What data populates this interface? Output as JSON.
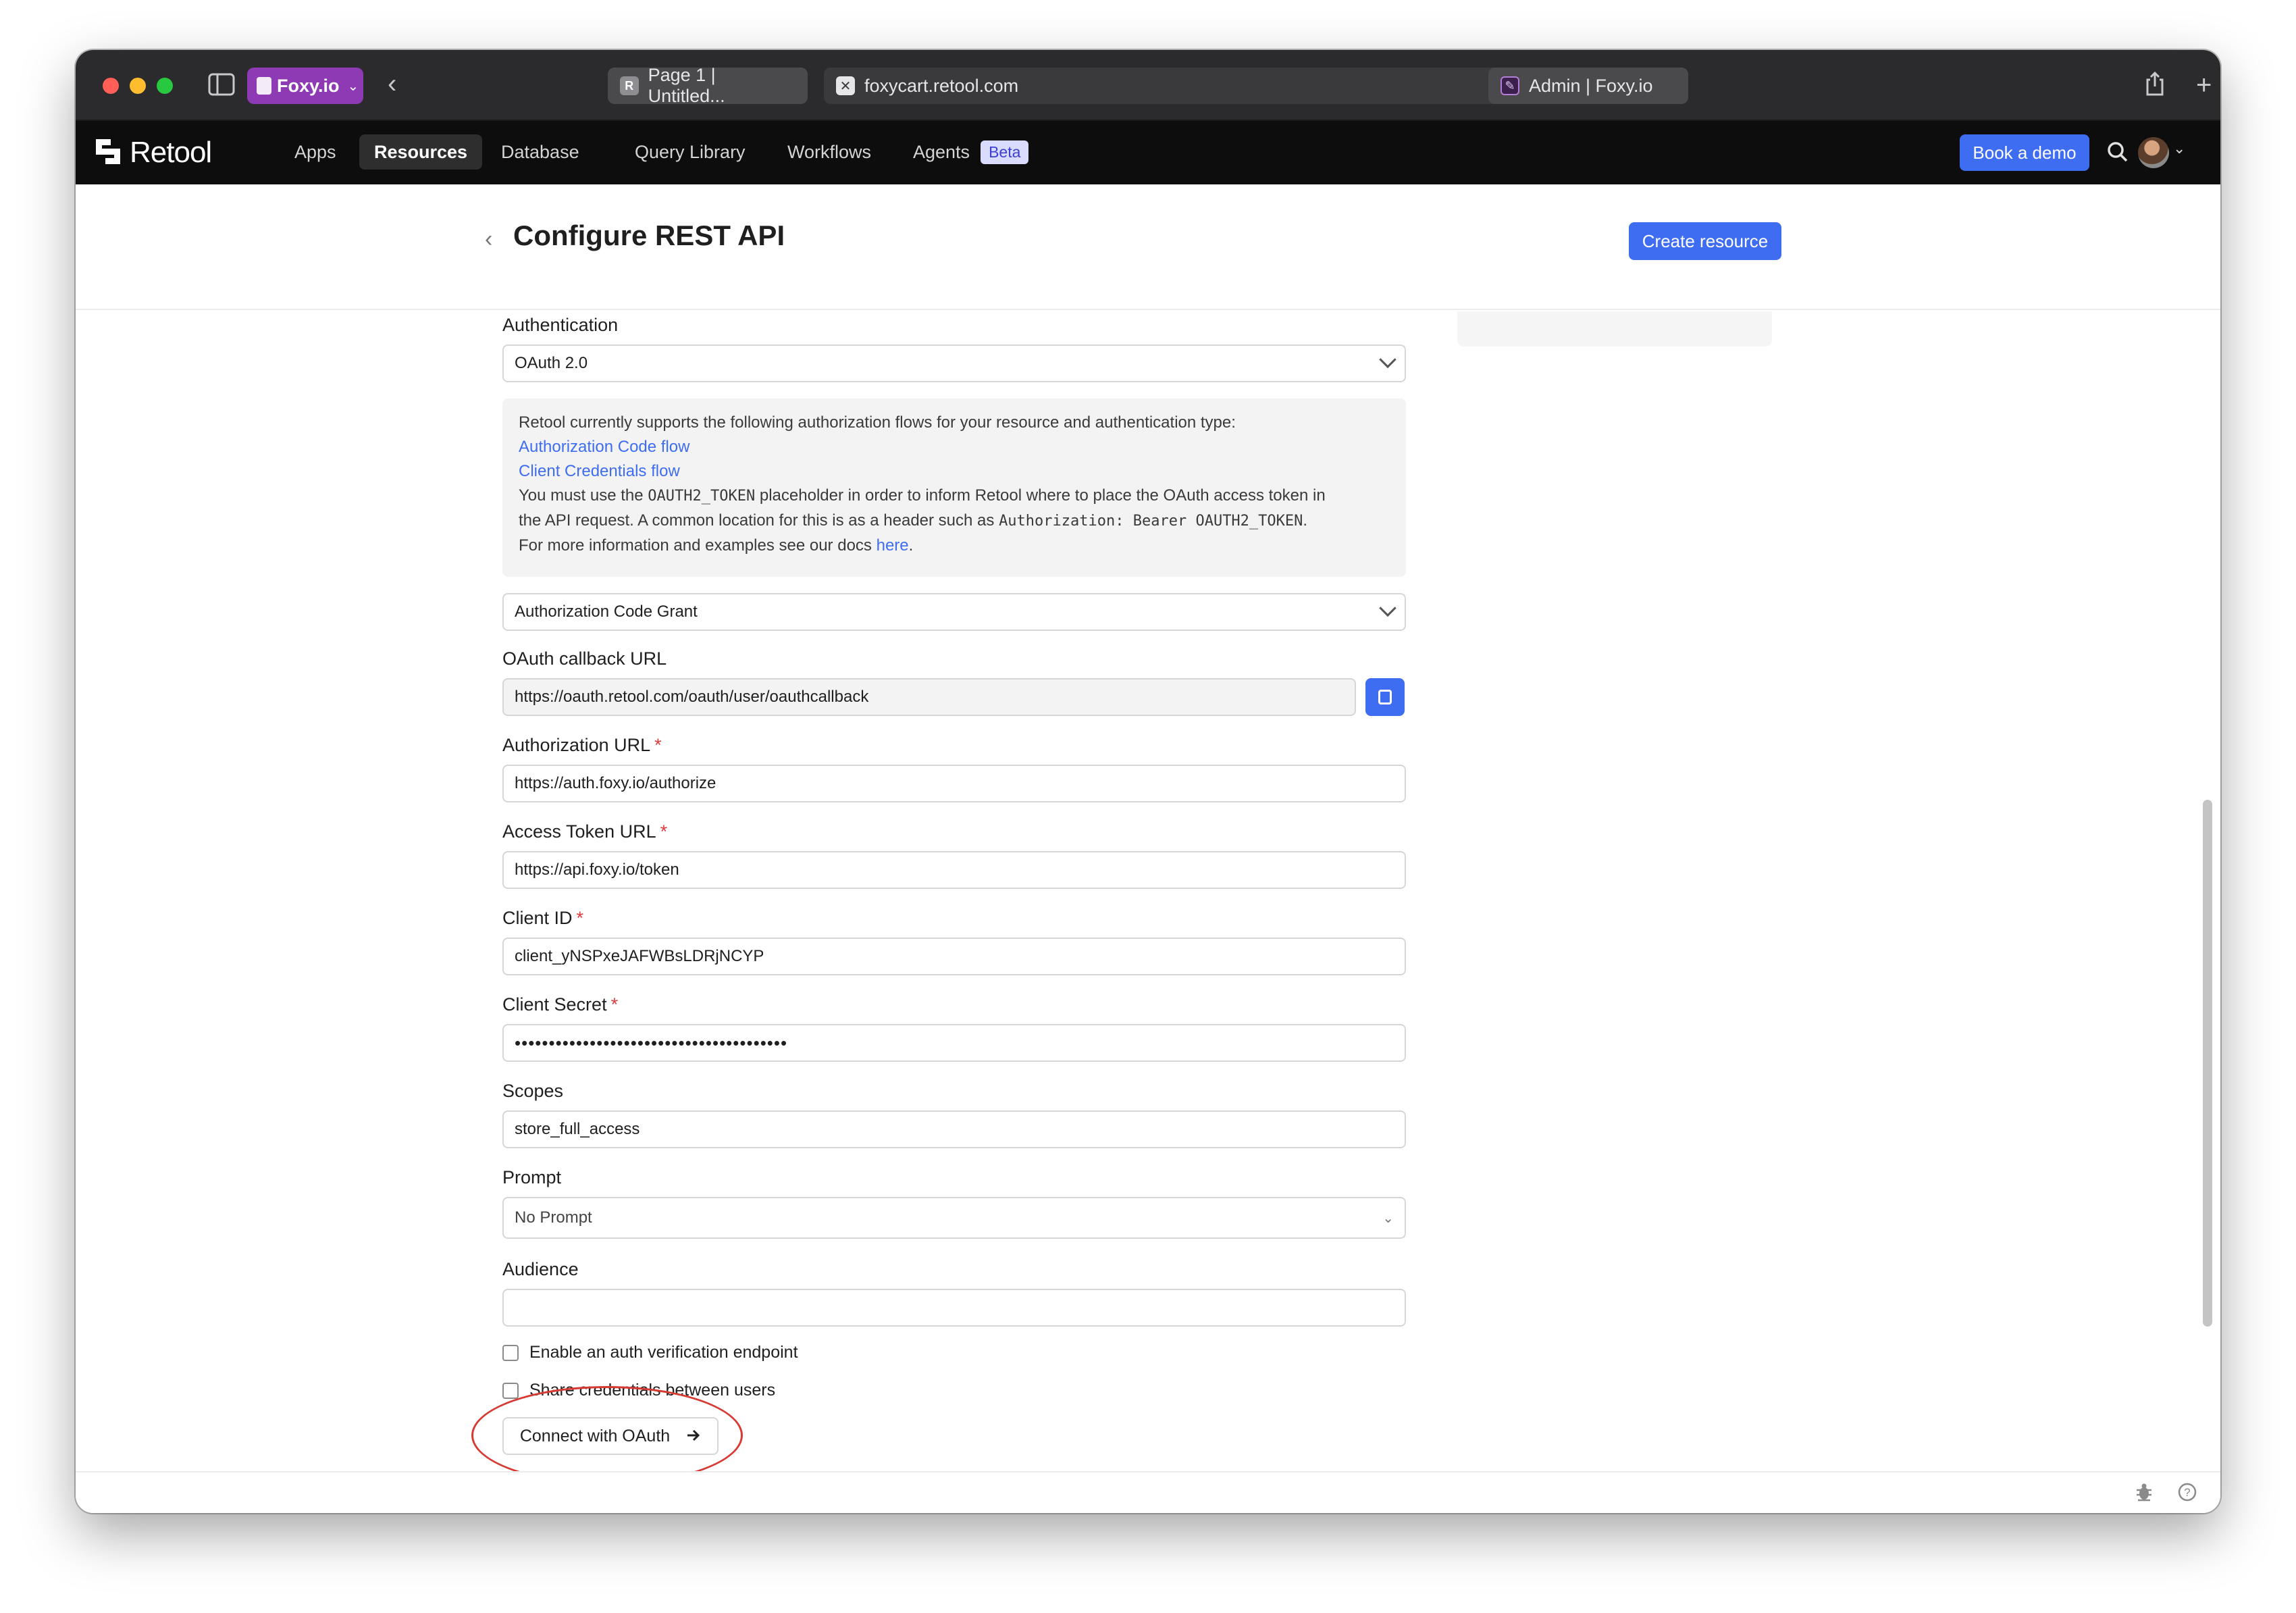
{
  "browser": {
    "profile_label": "Foxy.io",
    "tabs": [
      {
        "favicon": "R",
        "label": "Page 1 | Untitled..."
      },
      {
        "favicon": "x-logo",
        "label": "foxycart.retool.com"
      },
      {
        "favicon": "foxy-logo",
        "label": "Admin | Foxy.io"
      }
    ]
  },
  "app": {
    "logo_text": "Retool",
    "nav": [
      {
        "label": "Apps",
        "active": false
      },
      {
        "label": "Resources",
        "active": true
      },
      {
        "label": "Database",
        "active": false
      },
      {
        "label": "Query Library",
        "active": false
      },
      {
        "label": "Workflows",
        "active": false
      },
      {
        "label": "Agents",
        "active": false
      }
    ],
    "beta_badge": "Beta",
    "book_demo": "Book a demo"
  },
  "page": {
    "title": "Configure REST API",
    "create_button": "Create resource"
  },
  "form": {
    "authentication_label": "Authentication",
    "authentication_value": "OAuth 2.0",
    "info": {
      "intro": "Retool currently supports the following authorization flows for your resource and authentication type:",
      "link1": "Authorization Code flow",
      "link2": "Client Credentials flow",
      "line1_a": "You must use the",
      "token": "OAUTH2_TOKEN",
      "line1_b": "placeholder in order to inform Retool where to place the OAuth access token in",
      "line2_a": "the API request. A common location for this is as a header such as",
      "header_example": "Authorization: Bearer OAUTH2_TOKEN",
      "line2_b": ".",
      "line3_a": "For more information and examples see our docs",
      "here_link": "here",
      "line3_b": "."
    },
    "grant_type": "Authorization Code Grant",
    "callback_label": "OAuth callback URL",
    "callback_value": "https://oauth.retool.com/oauth/user/oauthcallback",
    "auth_url_label": "Authorization URL",
    "auth_url_value": "https://auth.foxy.io/authorize",
    "token_url_label": "Access Token URL",
    "token_url_value": "https://api.foxy.io/token",
    "client_id_label": "Client ID",
    "client_id_value": "client_yNSPxeJAFWBsLDRjNCYP",
    "client_secret_label": "Client Secret",
    "client_secret_value": "••••••••••••••••••••••••••••••••••••••••",
    "scopes_label": "Scopes",
    "scopes_value": "store_full_access",
    "prompt_label": "Prompt",
    "prompt_value": "No Prompt",
    "audience_label": "Audience",
    "audience_value": "",
    "checkbox_verify": "Enable an auth verification endpoint",
    "checkbox_share": "Share credentials between users",
    "connect_button": "Connect with OAuth",
    "required_marker": "*"
  },
  "colors": {
    "accent": "#3f6df2",
    "annotation": "#d63a32",
    "required": "#e0393e"
  }
}
